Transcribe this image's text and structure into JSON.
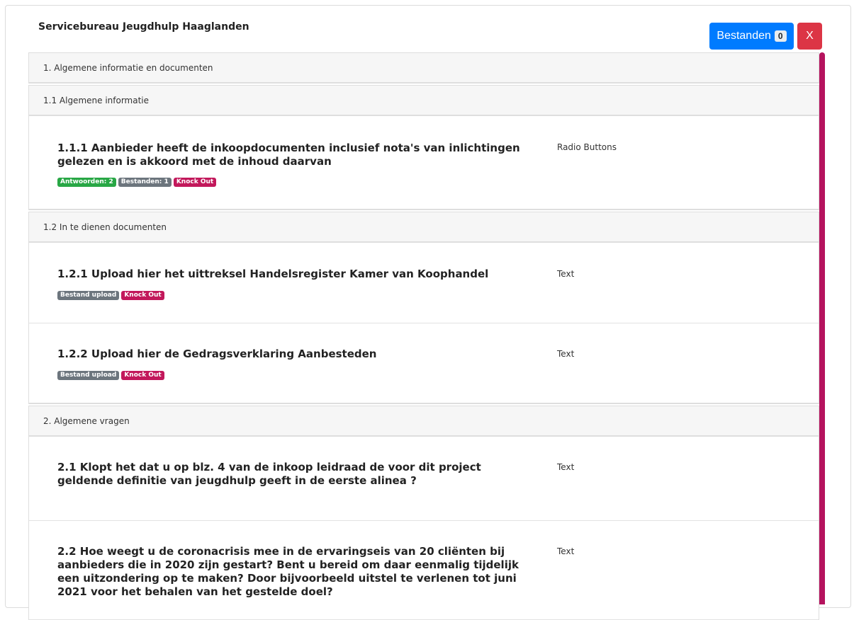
{
  "header": {
    "title": "Servicebureau Jeugdhulp Haaglanden",
    "files_button": "Bestanden",
    "files_count": "0",
    "close_button": "X"
  },
  "sections": [
    {
      "label": "1. Algemene informatie en documenten",
      "subsections": [
        {
          "label": "1.1 Algemene informatie",
          "questions": [
            {
              "text": "1.1.1 Aanbieder heeft de inkoopdocumenten inclusief nota's van inlichtingen gelezen en is akkoord met de inhoud daarvan",
              "type": "Radio Buttons",
              "badges": [
                "Antwoorden: 2",
                "Bestanden: 1",
                "Knock Out"
              ]
            }
          ]
        },
        {
          "label": "1.2 In te dienen documenten",
          "questions": [
            {
              "text": "1.2.1 Upload hier het uittreksel Handelsregister Kamer van Koophandel",
              "type": "Text",
              "badges": [
                "Bestand upload",
                "Knock Out"
              ]
            },
            {
              "text": "1.2.2 Upload hier de Gedragsverklaring Aanbesteden",
              "type": "Text",
              "badges": [
                "Bestand upload",
                "Knock Out"
              ]
            }
          ]
        }
      ]
    },
    {
      "label": "2. Algemene vragen",
      "questions": [
        {
          "text": "2.1 Klopt het dat u op blz. 4 van de inkoop leidraad de voor dit project geldende definitie van jeugdhulp geeft in de eerste alinea ?",
          "type": "Text"
        },
        {
          "text": "2.2 Hoe weegt u de coronacrisis mee in de ervaringseis van 20 cliënten bij aanbieders die in 2020 zijn gestart? Bent u bereid om daar eenmalig tijdelijk een uitzondering op te maken? Door bijvoorbeeld uitstel te verlenen tot juni 2021 voor het behalen van het gestelde doel?",
          "type": "Text"
        }
      ]
    }
  ],
  "colors": {
    "primary": "#007bff",
    "danger": "#dc3545",
    "success": "#28a745",
    "secondary": "#6c757d",
    "knockout": "#c2185b",
    "scrollbar": "#b5135e"
  }
}
